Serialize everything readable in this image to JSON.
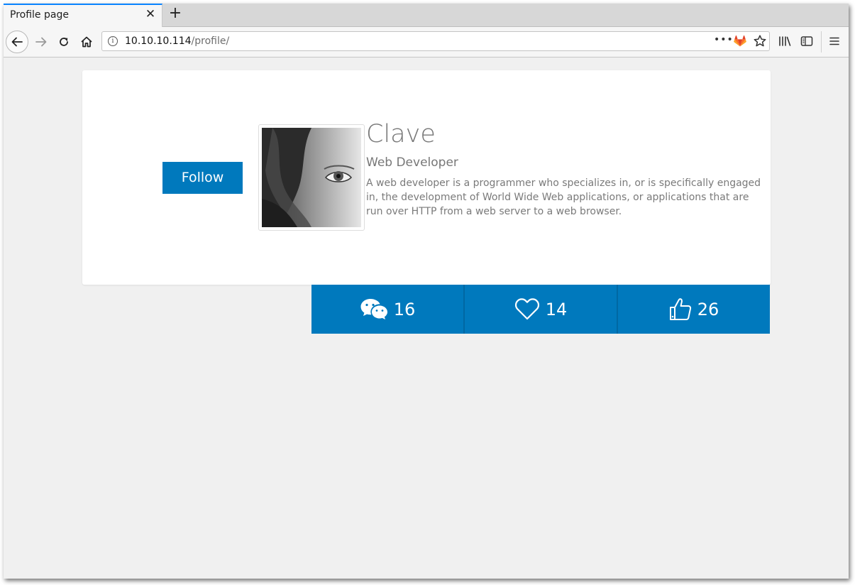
{
  "browser": {
    "tab_title": "Profile page",
    "tab_close": "✕",
    "new_tab": "+",
    "url_host": "10.10.10.114",
    "url_path": "/profile/",
    "url_more": "•••"
  },
  "profile": {
    "follow_label": "Follow",
    "name": "Clave",
    "role": "Web Developer",
    "bio": "A web developer is a programmer who specializes in, or is specifically engaged in, the development of World Wide Web applications, or applications that are run over HTTP from a web server to a web browser."
  },
  "stats": {
    "comments": "16",
    "likes": "14",
    "thumbs": "26"
  },
  "colors": {
    "accent": "#0079bd",
    "page_bg": "#f0f0f0"
  }
}
